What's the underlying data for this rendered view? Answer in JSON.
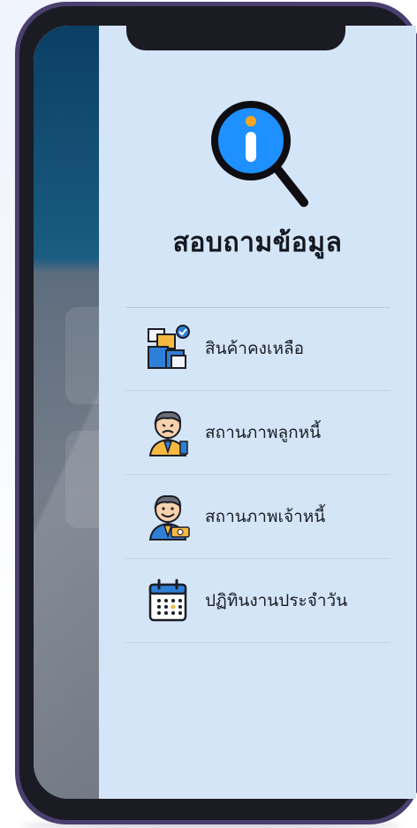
{
  "drawer": {
    "title": "สอบถามข้อมูล",
    "logo_icon": "info-magnifier-icon",
    "items": [
      {
        "label": "สินค้าคงเหลือ",
        "icon": "inventory-boxes-icon"
      },
      {
        "label": "สถานภาพลูกหนี้",
        "icon": "debtor-person-icon"
      },
      {
        "label": "สถานภาพเจ้าหนี้",
        "icon": "creditor-person-icon"
      },
      {
        "label": "ปฏิทินงานประจำวัน",
        "icon": "calendar-icon"
      }
    ]
  },
  "colors": {
    "frame": "#4a3f6e",
    "bezel": "#1b1b23",
    "drawer_bg": "#d4e5f8",
    "accent_blue": "#1e90ff",
    "back_app_header": "#0b3f63"
  }
}
